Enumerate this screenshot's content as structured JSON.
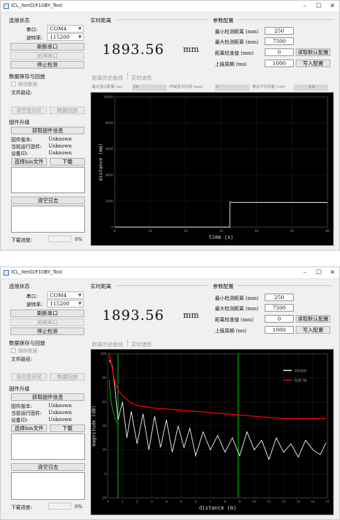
{
  "window": {
    "title": "ICL_XenD/F10BY_Tool",
    "min": "–",
    "max": "☐",
    "close": "✕",
    "icon": "app-icon"
  },
  "connect": {
    "group": "连接状态",
    "port_label": "串口:",
    "port_value": "COM4",
    "baud_label": "波特率:",
    "baud_value": "115200",
    "refresh": "刷新串口",
    "close": "关闭串口",
    "stop": "停止检测"
  },
  "realtime": {
    "group": "实时距离",
    "value": "1893.56",
    "unit": "mm"
  },
  "params": {
    "group": "参数配置",
    "min_label": "最小检测距离 (mm)",
    "min_value": "250",
    "max_label": "最大检测距离 (mm)",
    "max_value": "7500",
    "cal_label": "距离校准值 (mm)",
    "cal_value": "0",
    "period_label": "上报周期 (ms)",
    "period_value": "1000",
    "read_default": "读取默认配置",
    "write": "写入配置"
  },
  "save": {
    "group": "数据保存与回放",
    "save_check": "保存数据",
    "path_label": "文件路径:"
  },
  "tabs": {
    "history": "距离历史曲线",
    "wave": "实时波形"
  },
  "plotparams": {
    "max_dist_label": "最大显示距离 (m)",
    "max_dist_value": "10",
    "time_label": "时域显示时间 (min)",
    "time_value": "1",
    "smooth_label": "稳定平均功能 (cm)",
    "smooth_value": "5.9"
  },
  "playback": {
    "clear": "清空显示区",
    "replay": "数据回放"
  },
  "firmware": {
    "group": "固件升级",
    "get_info": "获取固件信息",
    "version_label": "固件版本:",
    "version_value": "Unknown",
    "running_label": "当前运行固件:",
    "running_value": "Unknown",
    "device_label": "设备ID:",
    "device_value": "Unknown",
    "select_bin": "选择bin文件",
    "download": "下载"
  },
  "log": {
    "clear": "清空日志"
  },
  "progress": {
    "label": "下载进度:",
    "value": "0%",
    "fraction": 0
  },
  "chart_data": [
    {
      "type": "line",
      "xlabel": "time (s)",
      "ylabel": "distance (mm)",
      "xlim": [
        0,
        60
      ],
      "ylim": [
        0,
        10000
      ],
      "xticks": [
        "0",
        "10",
        "20",
        "30",
        "40",
        "50",
        "60"
      ],
      "yticks": [
        "10000",
        "8000",
        "6000",
        "4000",
        "2000",
        "0"
      ],
      "series": [
        {
          "color": "#ffffff",
          "x": [
            0,
            32.5,
            32.5,
            33,
            60
          ],
          "y": [
            0,
            0,
            1940,
            1900,
            1890
          ]
        }
      ]
    },
    {
      "type": "line",
      "xlabel": "distance (m)",
      "ylabel": "magnitude (dB)",
      "xlim": [
        0,
        15
      ],
      "ylim": [
        -20,
        100
      ],
      "xticks": [
        "0",
        "1",
        "2",
        "3",
        "4",
        "5",
        "6",
        "7",
        "8",
        "9",
        "10",
        "11",
        "12",
        "13",
        "14",
        "15"
      ],
      "yticks": [
        "100",
        "80",
        "60",
        "40",
        "20",
        "0",
        "-20"
      ],
      "markers": [
        0.7,
        8.9
      ],
      "series": [
        {
          "name": "实时波形",
          "color": "#ffffff",
          "x": [
            0.1,
            0.3,
            0.5,
            0.7,
            1.0,
            1.3,
            1.6,
            2.0,
            2.4,
            2.8,
            3.2,
            3.6,
            4.0,
            4.4,
            4.8,
            5.2,
            5.6,
            6.0,
            6.5,
            7.0,
            7.5,
            8.0,
            8.5,
            9.0,
            9.5,
            10.0,
            10.5,
            11.0,
            11.5,
            12.0,
            12.5,
            13.0,
            13.5,
            14.0,
            14.5,
            14.9
          ],
          "y": [
            95,
            90,
            70,
            45,
            60,
            30,
            52,
            25,
            50,
            20,
            48,
            22,
            45,
            18,
            40,
            22,
            38,
            15,
            35,
            20,
            32,
            18,
            30,
            15,
            35,
            20,
            28,
            12,
            30,
            18,
            25,
            14,
            28,
            20,
            16,
            26
          ]
        },
        {
          "name": "检测门限",
          "color": "#ff0000",
          "x": [
            0.1,
            0.3,
            0.5,
            0.8,
            1.2,
            1.6,
            2.0,
            2.5,
            3.0,
            4.0,
            5.0,
            6.0,
            7.0,
            8.0,
            9.0,
            10.0,
            11.0,
            12.0,
            13.0,
            14.0,
            14.9
          ],
          "y": [
            100,
            88,
            75,
            68,
            63,
            59,
            57,
            56,
            55,
            54,
            53,
            52,
            51,
            50,
            49,
            48,
            47,
            46,
            46,
            46,
            46
          ]
        },
        {
          "color": "#00cc00",
          "x": [
            0.1,
            0.2,
            0.35,
            0.5,
            0.65
          ],
          "y": [
            78,
            62,
            52,
            46,
            42
          ]
        }
      ]
    }
  ]
}
